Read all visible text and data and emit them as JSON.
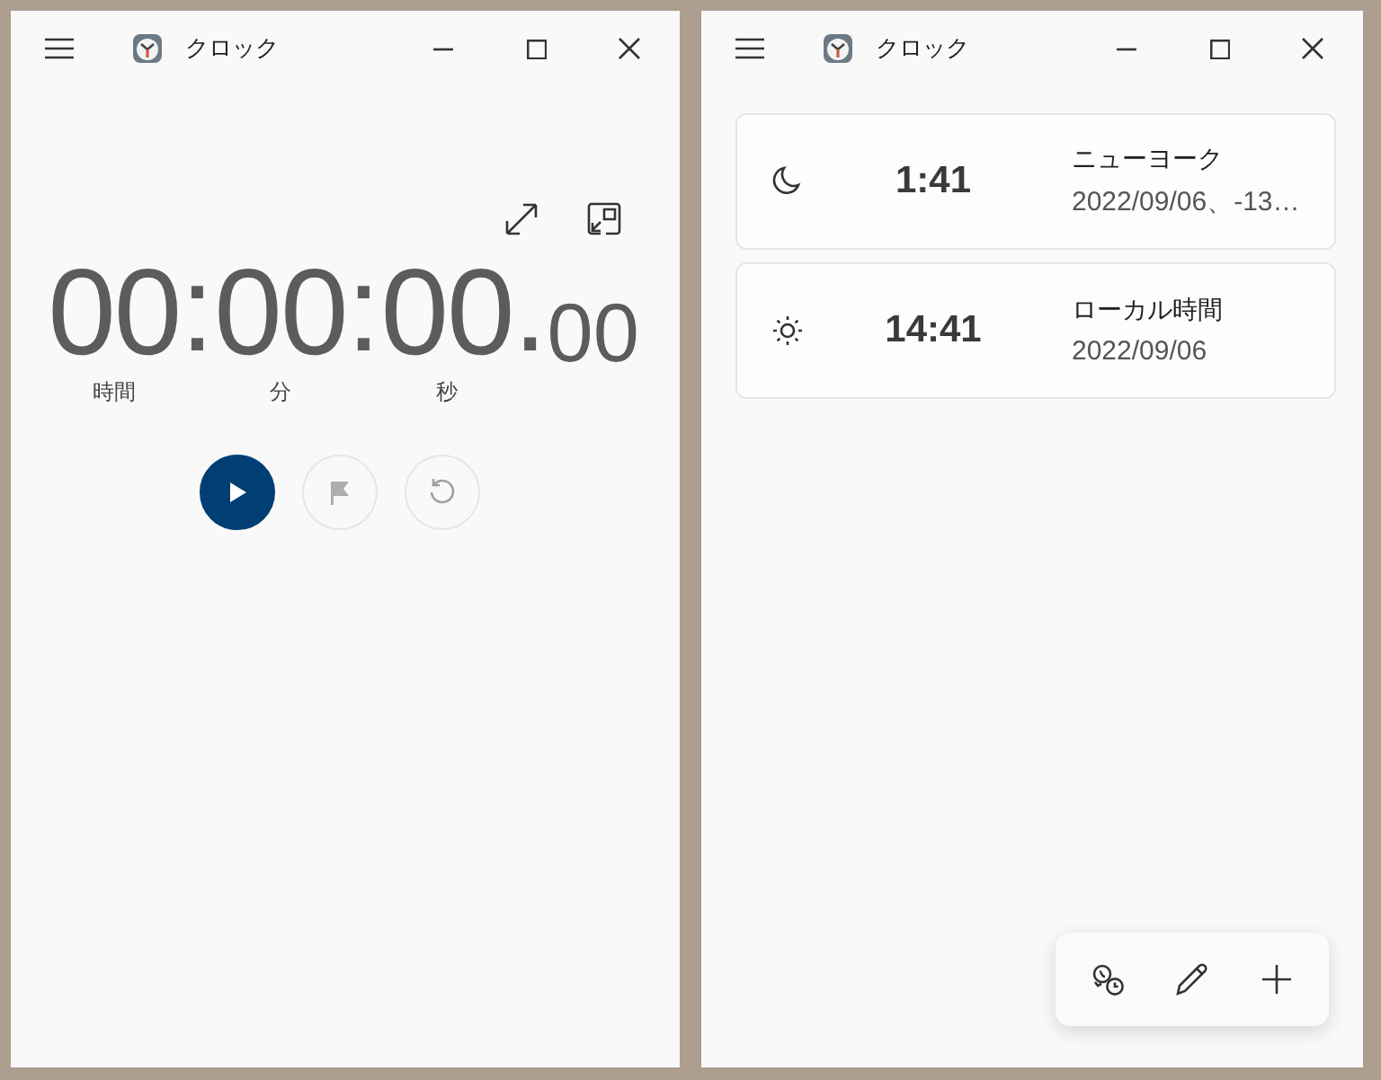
{
  "stopwatch_window": {
    "title": "クロック",
    "display": [
      {
        "kind": "unit",
        "value": "00",
        "label": "時間"
      },
      {
        "kind": "sep",
        "text": ":"
      },
      {
        "kind": "unit",
        "value": "00",
        "label": "分"
      },
      {
        "kind": "sep",
        "text": ":"
      },
      {
        "kind": "unit",
        "value": "00",
        "label": "秒"
      },
      {
        "kind": "point",
        "text": "."
      },
      {
        "kind": "fraction",
        "text": "00"
      }
    ],
    "buttons": [
      {
        "kind": "play",
        "disabled": false
      },
      {
        "kind": "lap",
        "disabled": true
      },
      {
        "kind": "reset",
        "disabled": true
      }
    ]
  },
  "world_clock_window": {
    "title": "クロック",
    "clocks": [
      {
        "kind": "night",
        "time": "1:41",
        "city": "ニューヨーク",
        "detail": "2022/09/06、-13…"
      },
      {
        "kind": "day",
        "time": "14:41",
        "city": "ローカル時間",
        "detail": "2022/09/06"
      }
    ]
  }
}
